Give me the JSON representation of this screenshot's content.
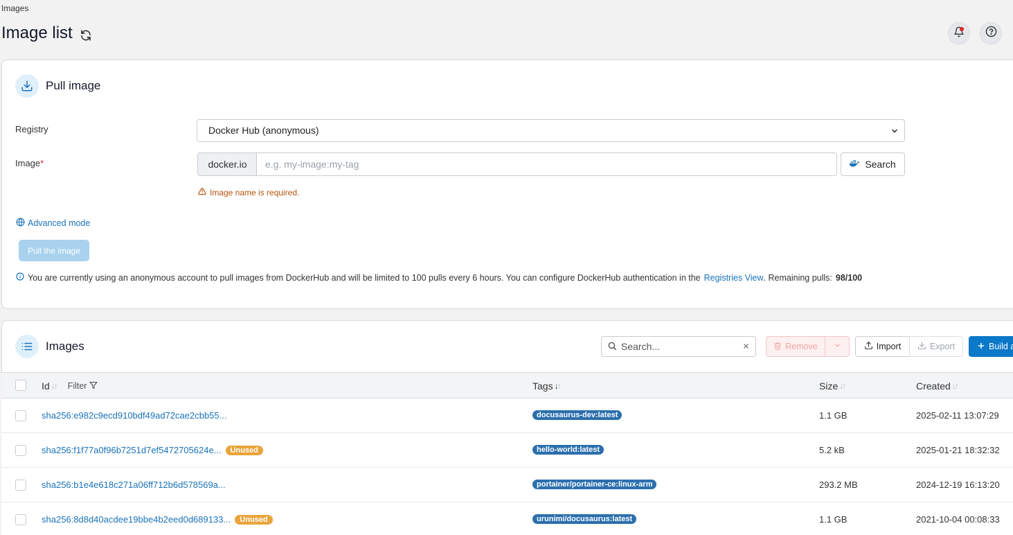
{
  "breadcrumb": "Images",
  "page_title": "Image list",
  "pull": {
    "title": "Pull image",
    "registry_label": "Registry",
    "registry_value": "Docker Hub (anonymous)",
    "image_label": "Image",
    "image_required_mark": "*",
    "image_prefix": "docker.io",
    "image_placeholder": "e.g. my-image:my-tag",
    "search_label": "Search",
    "error": "Image name is required.",
    "advanced_mode": "Advanced mode",
    "pull_button": "Pull the image",
    "info_text": "You are currently using an anonymous account to pull images from DockerHub and will be limited to 100 pulls every 6 hours. You can configure DockerHub authentication in the",
    "info_link": "Registries View",
    "info_after": ". Remaining pulls:",
    "remaining_pulls": "98/100"
  },
  "images": {
    "title": "Images",
    "search_placeholder": "Search...",
    "remove_label": "Remove",
    "import_label": "Import",
    "export_label": "Export",
    "build_label": "Build a",
    "columns": {
      "id": "Id",
      "filter": "Filter",
      "tags": "Tags",
      "size": "Size",
      "created": "Created"
    },
    "rows": [
      {
        "id": "sha256:e982c9ecd910bdf49ad72cae2cbb55...",
        "unused": "",
        "tag": "docusaurus-dev:latest",
        "size": "1.1 GB",
        "created": "2025-02-11 13:07:29"
      },
      {
        "id": "sha256:f1f77a0f96b7251d7ef5472705624e...",
        "unused": "Unused",
        "tag": "hello-world:latest",
        "size": "5.2 kB",
        "created": "2025-01-21 18:32:32"
      },
      {
        "id": "sha256:b1e4e618c271a06ff712b6d578569a...",
        "unused": "",
        "tag": "portainer/portainer-ce:linux-arm",
        "size": "293.2 MB",
        "created": "2024-12-19 16:13:20"
      },
      {
        "id": "sha256:8d8d40acdee19bbe4b2eed0d689133...",
        "unused": "Unused",
        "tag": "urunimi/docusaurus:latest",
        "size": "1.1 GB",
        "created": "2021-10-04 00:08:33"
      }
    ]
  },
  "colors": {
    "accent": "#0b78c8",
    "link": "#1a73b8",
    "tag_bg": "#2b6fad",
    "unused_bg": "#e9a43b",
    "error": "#b4530b"
  }
}
